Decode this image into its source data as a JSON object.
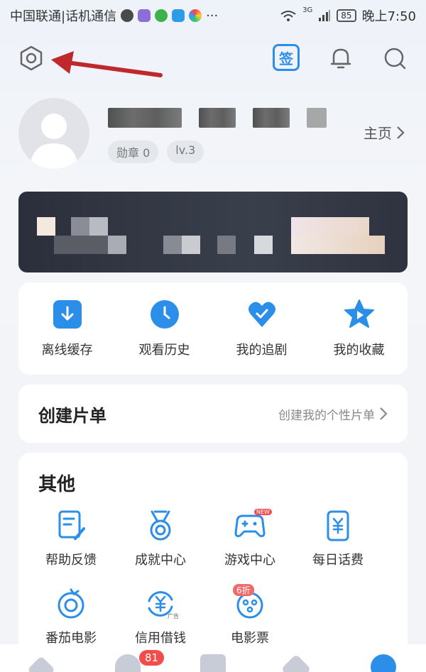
{
  "status_bar": {
    "carrier": "中国联通|话机通信",
    "more": "···",
    "network": "3G",
    "battery": "85",
    "time": "晚上7:50"
  },
  "top_bar": {
    "sign_label": "签"
  },
  "profile": {
    "username": "",
    "medal": "勋章 0",
    "level": "lv.3",
    "homepage": "主页"
  },
  "quick_menu": {
    "items": [
      {
        "label": "离线缓存",
        "icon": "download-icon",
        "color": "#2b8ee8"
      },
      {
        "label": "观看历史",
        "icon": "clock-icon",
        "color": "#2b8ee8"
      },
      {
        "label": "我的追剧",
        "icon": "heart-check-icon",
        "color": "#2b8ee8"
      },
      {
        "label": "我的收藏",
        "icon": "star-icon",
        "color": "#2b8ee8"
      }
    ]
  },
  "create_list": {
    "title": "创建片单",
    "link": "创建我的个性片单"
  },
  "others": {
    "title": "其他",
    "items": [
      {
        "label": "帮助反馈",
        "icon": "feedback-icon"
      },
      {
        "label": "成就中心",
        "icon": "medal-icon"
      },
      {
        "label": "游戏中心",
        "icon": "gamepad-icon",
        "tag": "NEW"
      },
      {
        "label": "每日话费",
        "icon": "phone-yuan-icon"
      },
      {
        "label": "番茄电影",
        "icon": "tomato-movie-icon"
      },
      {
        "label": "信用借钱",
        "icon": "credit-loan-icon",
        "tag": "广告"
      },
      {
        "label": "电影票",
        "icon": "movie-ticket-icon",
        "tag": "6折"
      }
    ]
  },
  "bottom_nav": {
    "badge": "81"
  },
  "colors": {
    "accent": "#2b8ee8",
    "arrow": "#c0292b",
    "badge": "#f24c4c"
  }
}
